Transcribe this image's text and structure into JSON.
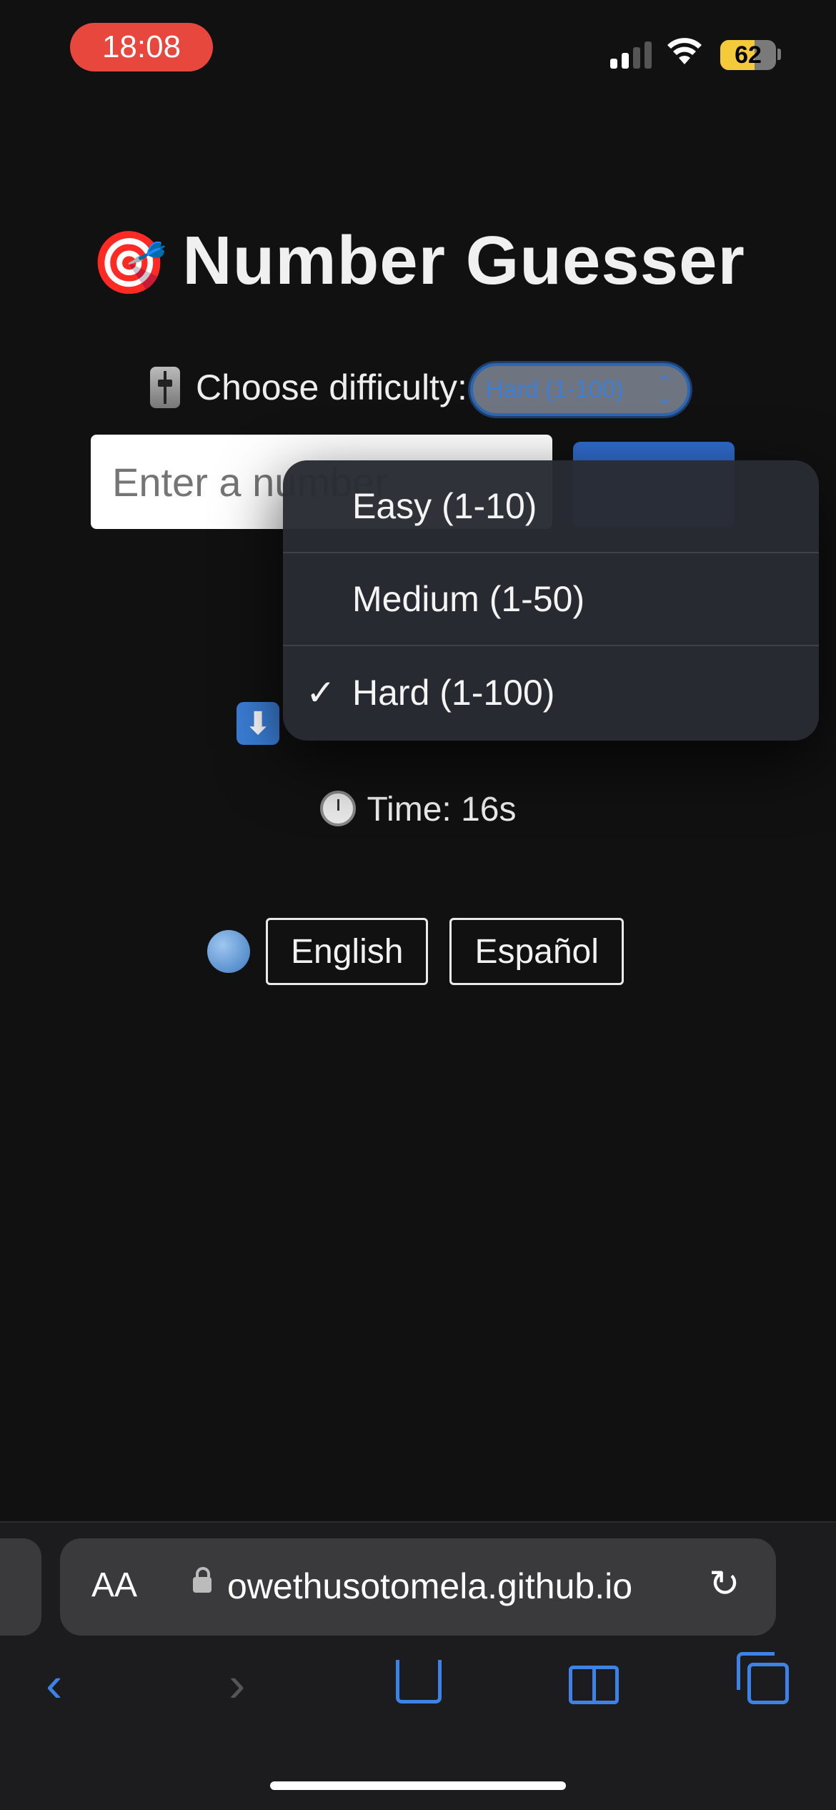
{
  "status_bar": {
    "time": "18:08",
    "battery": "62"
  },
  "page": {
    "title_emoji": "🎯",
    "title": "Number Guesser",
    "difficulty_label": "Choose difficulty:",
    "difficulty_selected": "Hard (1-100)",
    "input_placeholder": "Enter a number",
    "timer_text": "Time: 16s",
    "languages": [
      "English",
      "Español"
    ]
  },
  "dropdown": {
    "options": [
      {
        "label": "Easy (1-10)",
        "checked": false
      },
      {
        "label": "Medium (1-50)",
        "checked": false
      },
      {
        "label": "Hard (1-100)",
        "checked": true
      }
    ],
    "check_glyph": "✓"
  },
  "browser": {
    "text_size_label": "AA",
    "url": "owethusotomela.github.io"
  }
}
